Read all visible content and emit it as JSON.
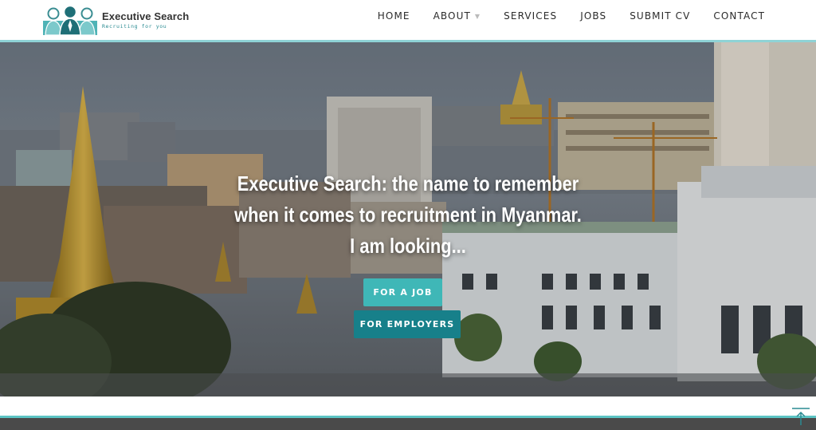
{
  "header": {
    "logo": {
      "title": "Executive Search",
      "tagline": "Recruiting for you",
      "icon": "people-group-icon"
    },
    "nav": [
      {
        "label": "HOME"
      },
      {
        "label": "ABOUT",
        "has_dropdown": true
      },
      {
        "label": "SERVICES"
      },
      {
        "label": "JOBS"
      },
      {
        "label": "SUBMIT CV"
      },
      {
        "label": "CONTACT"
      }
    ]
  },
  "hero": {
    "lines": [
      "Executive Search: the name to remember",
      "when it comes to recruitment in Myanmar.",
      "I am looking..."
    ],
    "buttons": {
      "job": "FOR A JOB",
      "employers": "FOR EMPLOYERS"
    }
  },
  "colors": {
    "accent_light": "#3fb7b7",
    "accent_dark": "#17808a",
    "rule": "#8fd3d6",
    "footer": "#4a4a4a"
  },
  "scroll_top": {
    "icon": "arrow-up-icon"
  }
}
